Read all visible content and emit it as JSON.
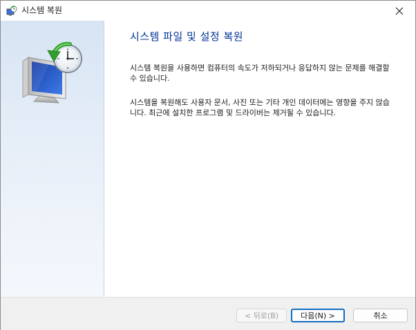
{
  "window": {
    "title": "시스템 복원",
    "close_icon": "close-icon"
  },
  "content": {
    "heading": "시스템 파일 및 설정 복원",
    "paragraph1": "시스템 복원을 사용하면 컴퓨터의 속도가 저하되거나 응답하지 않는 문제를 해결할 수 있습니다.",
    "paragraph2": "시스템을 복원해도 사용자 문서, 사진 또는 기타 개인 데이터에는 영향을 주지 않습니다. 최근에 설치한 프로그램 및 드라이버는 제거될 수 있습니다."
  },
  "footer": {
    "back_label": "< 뒤로(B)",
    "next_label": "다음(N) >",
    "cancel_label": "취소"
  },
  "colors": {
    "heading": "#003399",
    "accent_border": "#0f6cbd",
    "disabled_text": "#9d9d9d"
  }
}
